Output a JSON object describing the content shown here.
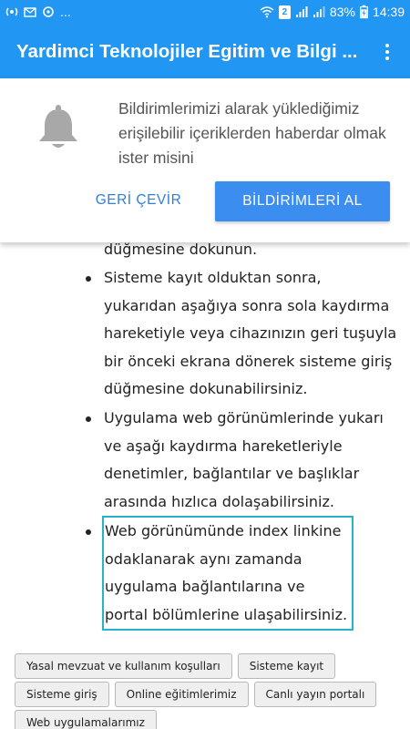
{
  "status_bar": {
    "left_icons": [
      "hotspot-icon",
      "mail-icon",
      "sync-icon"
    ],
    "more": "...",
    "sim_badge": "2",
    "battery": "83%",
    "time": "14:39"
  },
  "app_bar": {
    "title": "Yardimci Teknolojiler Egitim ve Bilgi ...",
    "menu_icon": "more-vert-icon"
  },
  "prompt": {
    "icon": "bell-icon",
    "message": "Bildirimlerimizi alarak yüklediğimiz erişilebilir içeriklerden haberdar olmak ister misini",
    "cancel_label": "GERİ ÇEVİR",
    "allow_label": "BİLDİRİMLERİ AL"
  },
  "main": {
    "partial_line": "düğmesine dokunun.",
    "items": [
      "Sisteme kayıt olduktan sonra, yukarıdan aşağıya sonra sola kaydırma hareketiyle veya cihazınızın geri tuşuyla bir önceki ekrana dönerek sisteme giriş düğmesine dokunabilirsiniz.",
      "Uygulama web görünümlerinde yukarı ve aşağı kaydırma hareketleriyle denetimler, bağlantılar ve başlıklar arasında hızlıca dolaşabilirsiniz.",
      "Web görünümünde index linkine odaklanarak aynı zamanda uygulama bağlantılarına ve portal bölümlerine ulaşabilirsiniz."
    ],
    "buttons": [
      "Yasal mevzuat ve kullanım koşulları",
      "Sisteme kayıt",
      "Sisteme giriş",
      "Online eğitimlerimiz",
      "Canlı yayın portalı",
      "Web uygulamalarımız"
    ]
  },
  "colors": {
    "primary": "#2196f3",
    "focus_outline": "#25b5c7",
    "allow_button": "#3b8ef0",
    "cancel_text": "#2f7fd8"
  }
}
